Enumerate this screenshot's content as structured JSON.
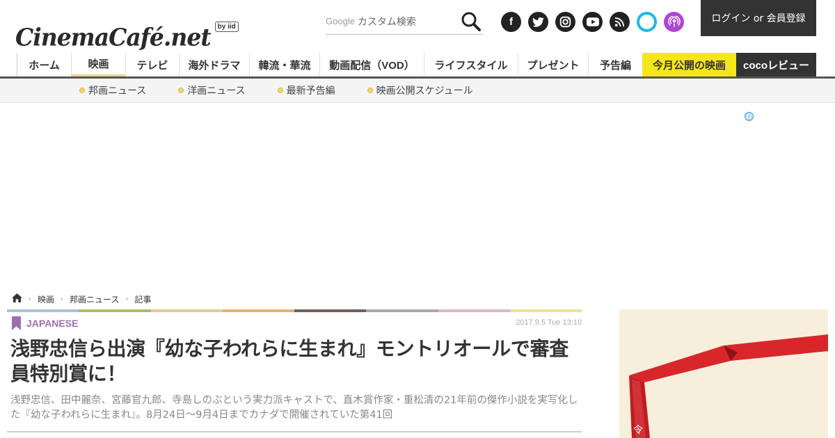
{
  "brand": {
    "logo": "CinemaCafé.net",
    "logo_sub": "by iid"
  },
  "search": {
    "provider": "Google",
    "placeholder": "カスタム検索"
  },
  "social": [
    {
      "name": "facebook",
      "glyph": "f"
    },
    {
      "name": "twitter",
      "glyph": "t"
    },
    {
      "name": "instagram",
      "glyph": "◎"
    },
    {
      "name": "youtube",
      "glyph": "▶"
    },
    {
      "name": "rss",
      "glyph": "◉"
    },
    {
      "name": "alexa",
      "glyph": ""
    },
    {
      "name": "podcast",
      "glyph": "◎"
    }
  ],
  "login_label": "ログイン or 会員登録",
  "nav": [
    {
      "label": "ホーム",
      "w": 0
    },
    {
      "label": "映画"
    },
    {
      "label": "テレビ"
    },
    {
      "label": "海外ドラマ"
    },
    {
      "label": "韓流・華流"
    },
    {
      "label": "動画配信（VOD）"
    },
    {
      "label": "ライフスタイル"
    },
    {
      "label": "プレゼント"
    },
    {
      "label": "予告編"
    },
    {
      "label": "今月公開の映画"
    },
    {
      "label": "cocoレビュー"
    }
  ],
  "subnav": [
    "邦画ニュース",
    "洋画ニュース",
    "最新予告編",
    "映画公開スケジュール"
  ],
  "breadcrumb": [
    "映画",
    "邦画ニュース",
    "記事"
  ],
  "colors": {
    "accent_yellow": "#f5e61a",
    "category": "#9c6fb0",
    "colorbar": [
      "#a8c4d8",
      "#a8c060",
      "#e8c898",
      "#e8b070",
      "#706058",
      "#a8a8a8",
      "#e0b8c0",
      "#f0e090"
    ]
  },
  "article": {
    "category": "JAPANESE",
    "date": "2017.9.5 Tue 13:10",
    "title": "浅野忠信ら出演『幼な子われらに生まれ』モントリオールで審査員特別賞に！",
    "lead": "浅野忠信、田中麗奈、宮藤官九郎、寺島しのぶという実力派キャストで、直木賞作家・重松清の21年前の傑作小説を実写化した『幼な子われらに生まれ』。8月24日～9月4日までカナダで開催されていた第41回"
  },
  "ad_info": "ⓘ"
}
